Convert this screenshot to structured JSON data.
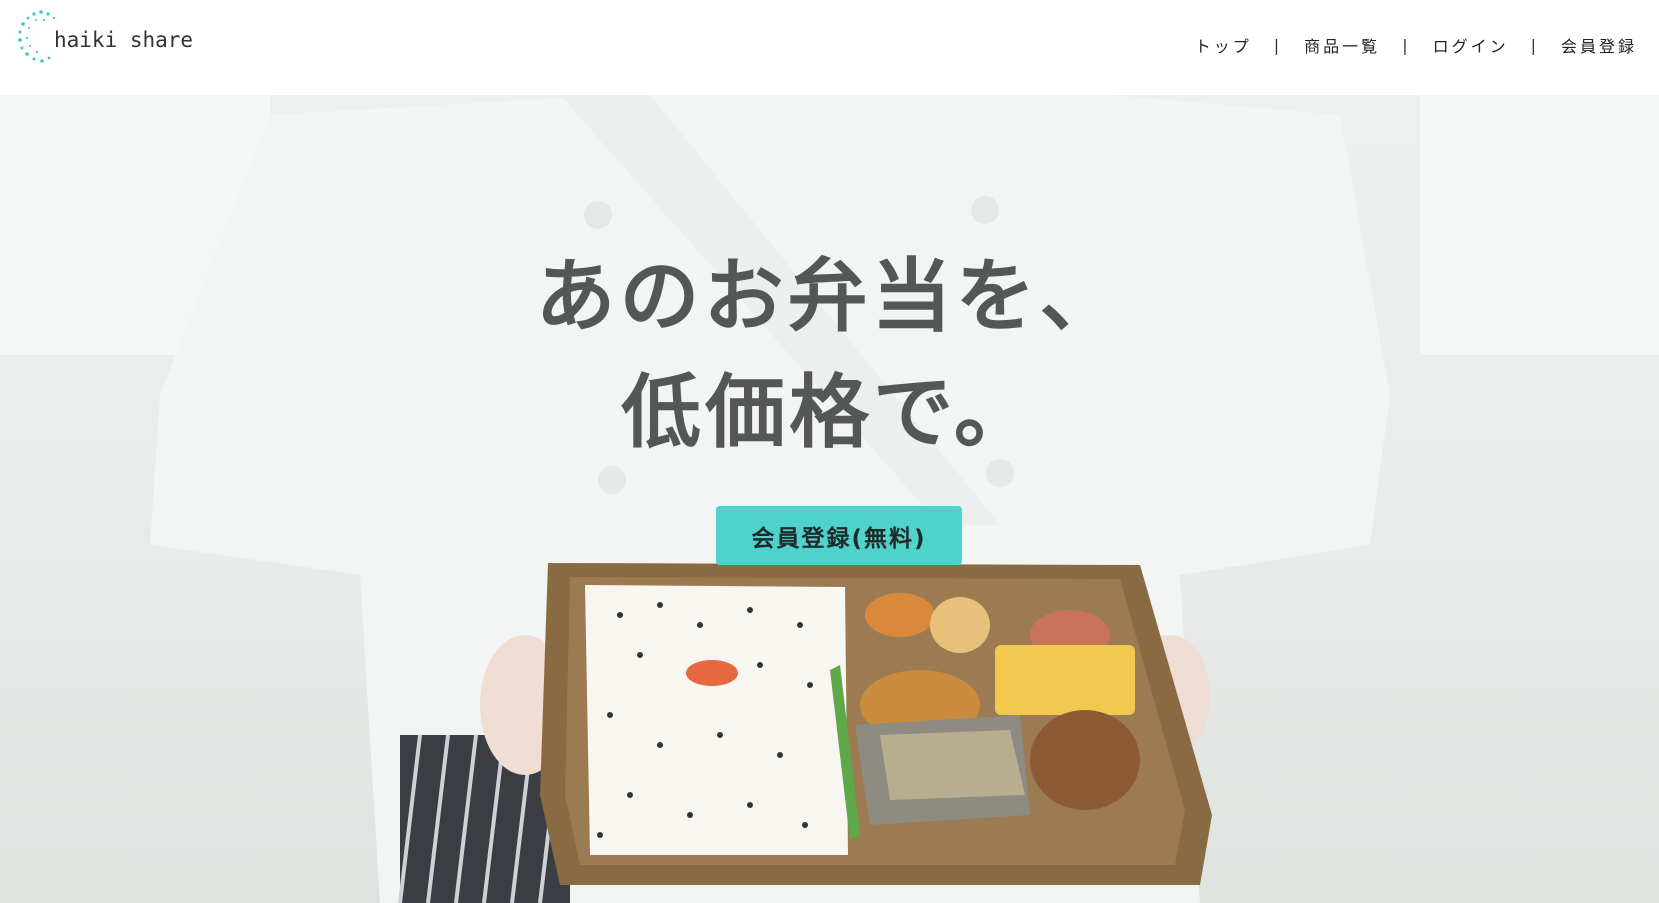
{
  "header": {
    "logo_text": "haiki share",
    "logo_icon": "dotted-circle-logo-icon",
    "nav": [
      {
        "label": "トップ"
      },
      {
        "label": "商品一覧"
      },
      {
        "label": "ログイン"
      },
      {
        "label": "会員登録"
      }
    ],
    "nav_separator": "|"
  },
  "hero": {
    "headline_line1": "あのお弁当を、",
    "headline_line2": "低価格で。",
    "cta_label": "会員登録(無料)",
    "image": "chef-holding-bento-box-photo"
  },
  "colors": {
    "accent": "#4fd1cc",
    "headline": "#555656",
    "logo_dots": "#3cc9c3"
  }
}
